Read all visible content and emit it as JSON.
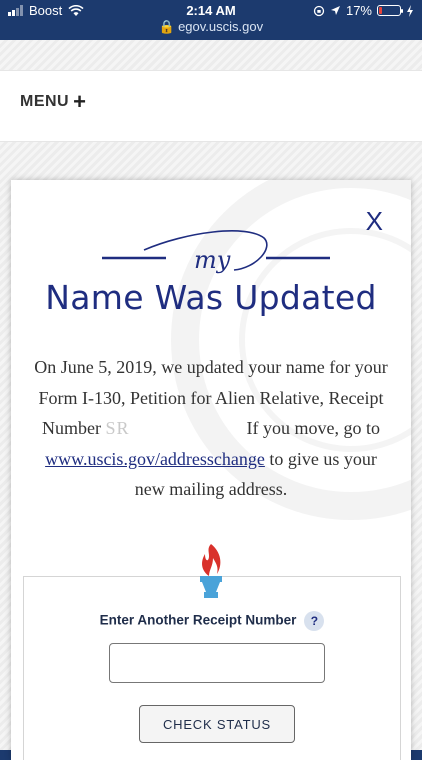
{
  "status_bar": {
    "carrier": "Boost",
    "time": "2:14 AM",
    "battery": "17%",
    "battery_level": 0.17,
    "url": "egov.uscis.gov"
  },
  "nav": {
    "menu_label": "MENU",
    "menu_plus": "+"
  },
  "modal": {
    "close_label": "X",
    "flourish_text": "my",
    "title": "Name Was Updated",
    "body_line1": "On June 5, 2019, we updated your name for your Form I-130, Petition for Alien Relative, Receipt Number",
    "redacted_receipt": "SR",
    "body_line2": "If you move, go to",
    "link_text": "www.uscis.gov/addresschange",
    "body_line3": "to give us your new mailing address."
  },
  "receipt": {
    "label": "Enter Another Receipt Number",
    "help_label": "?",
    "input_value": "",
    "button_label": "CHECK STATUS"
  },
  "colors": {
    "brand_navy": "#1f2d80",
    "status_bar": "#1c3a6e",
    "torch_flame": "#d9312b",
    "torch_base": "#4aa3d9"
  }
}
